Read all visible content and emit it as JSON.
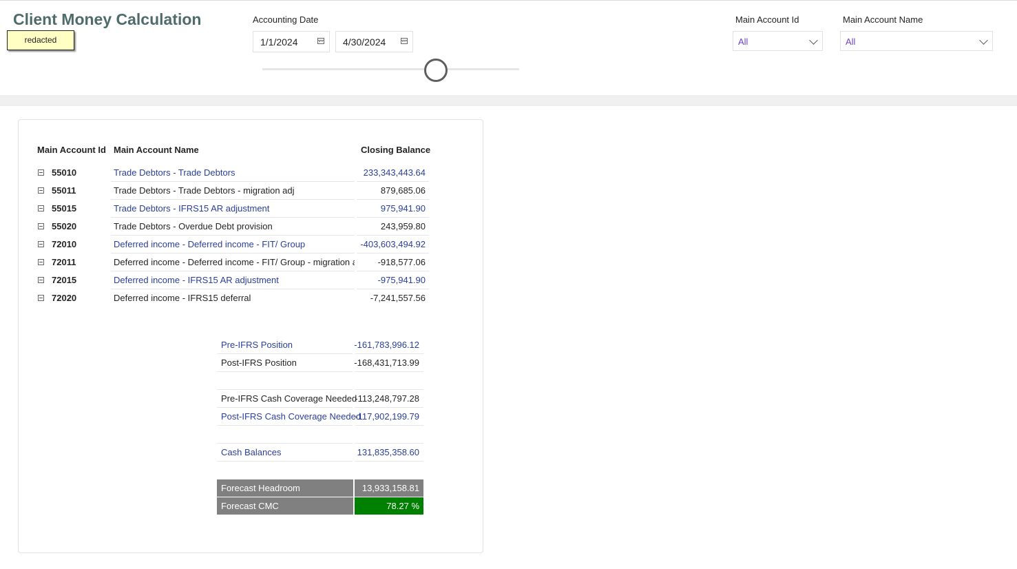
{
  "header": {
    "title": "Client Money Calculation",
    "redacted_note": "redacted",
    "accounting_date_label": "Accounting Date",
    "start_date": "1/1/2024",
    "end_date": "4/30/2024",
    "main_account_id_label": "Main Account Id",
    "main_account_id_value": "All",
    "main_account_name_label": "Main Account Name",
    "main_account_name_value": "All"
  },
  "table": {
    "columns": [
      "Main Account Id",
      "Main Account Name",
      "Closing Balance"
    ],
    "rows": [
      {
        "id": "55010",
        "name": "Trade Debtors - Trade Debtors",
        "balance": "233,343,443.64",
        "color": "#2a3f9b"
      },
      {
        "id": "55011",
        "name": "Trade Debtors - Trade Debtors - migration adj",
        "balance": "879,685.06",
        "color": "#252423"
      },
      {
        "id": "55015",
        "name": "Trade Debtors - IFRS15 AR adjustment",
        "balance": "975,941.90",
        "color": "#2a3f9b"
      },
      {
        "id": "55020",
        "name": "Trade Debtors - Overdue Debt provision",
        "balance": "243,959.80",
        "color": "#252423"
      },
      {
        "id": "72010",
        "name": "Deferred income - Deferred income - FIT/ Group",
        "balance": "-403,603,494.92",
        "color": "#2a3f9b"
      },
      {
        "id": "72011",
        "name": "Deferred income - Deferred income - FIT/ Group - migration a",
        "balance": "-918,577.06",
        "color": "#252423"
      },
      {
        "id": "72015",
        "name": "Deferred income - IFRS15 AR adjustment",
        "balance": "-975,941.90",
        "color": "#2a3f9b"
      },
      {
        "id": "72020",
        "name": "Deferred income - IFRS15 deferral",
        "balance": "-7,241,557.56",
        "color": "#252423"
      }
    ]
  },
  "summary": {
    "pre_ifrs_position_label": "Pre-IFRS Position",
    "pre_ifrs_position_value": "-161,783,996.12",
    "post_ifrs_position_label": "Post-IFRS Position",
    "post_ifrs_position_value": "-168,431,713.99",
    "pre_ifrs_cash_label": "Pre-IFRS Cash Coverage Needed",
    "pre_ifrs_cash_value": "-113,248,797.28",
    "post_ifrs_cash_label": "Post-IFRS Cash Coverage Needed",
    "post_ifrs_cash_value": "-117,902,199.79",
    "cash_balances_label": "Cash Balances",
    "cash_balances_value": "131,835,358.60",
    "forecast_headroom_label": "Forecast Headroom",
    "forecast_headroom_value": "13,933,158.81",
    "forecast_cmc_label": "Forecast CMC",
    "forecast_cmc_value": "78.27 %"
  },
  "colors": {
    "link_blue": "#2a3f9b",
    "forecast_gray": "#808080",
    "cmc_green": "#008000",
    "slicer_purple": "#6b42c4"
  },
  "icons": [
    "calendar-icon",
    "chevron-down-icon",
    "collapse-icon"
  ]
}
